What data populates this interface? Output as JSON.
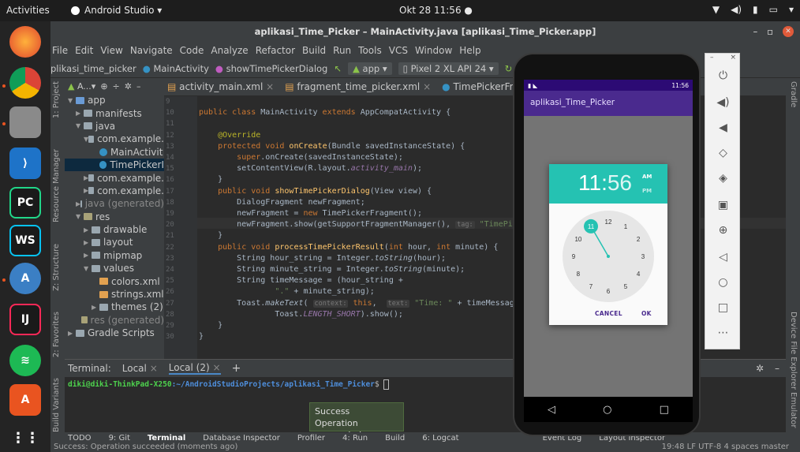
{
  "topbar": {
    "activities": "Activities",
    "app_name": "Android Studio ▾",
    "clock": "Okt 28 11:56  ●"
  },
  "window": {
    "title": "aplikasi_Time_Picker – MainActivity.java [aplikasi_Time_Picker.app]"
  },
  "menu": [
    "File",
    "Edit",
    "View",
    "Navigate",
    "Code",
    "Analyze",
    "Refactor",
    "Build",
    "Run",
    "Tools",
    "VCS",
    "Window",
    "Help"
  ],
  "nav": {
    "project": "plikasi_time_picker",
    "class": "MainActivity",
    "method": "showTimePickerDialog",
    "run_config": "app ▾",
    "device": "Pixel 2 XL API 24 ▾"
  },
  "project_panel": {
    "header": "A...▾",
    "tree": [
      {
        "label": "app",
        "indent": 0,
        "type": "fold-blue",
        "arrow": "▼"
      },
      {
        "label": "manifests",
        "indent": 1,
        "type": "fold",
        "arrow": "▶"
      },
      {
        "label": "java",
        "indent": 1,
        "type": "fold",
        "arrow": "▼"
      },
      {
        "label": "com.example.",
        "indent": 2,
        "type": "fold",
        "arrow": "▼"
      },
      {
        "label": "MainActivit",
        "indent": 3,
        "type": "cls",
        "arrow": ""
      },
      {
        "label": "TimePickerI",
        "indent": 3,
        "type": "cls",
        "arrow": "",
        "selected": true
      },
      {
        "label": "com.example.",
        "indent": 2,
        "type": "fold",
        "arrow": "▶"
      },
      {
        "label": "com.example.",
        "indent": 2,
        "type": "fold",
        "arrow": "▶"
      },
      {
        "label": "java (generated)",
        "indent": 1,
        "type": "fold",
        "arrow": "▶"
      },
      {
        "label": "res",
        "indent": 1,
        "type": "fold-res",
        "arrow": "▼"
      },
      {
        "label": "drawable",
        "indent": 2,
        "type": "fold",
        "arrow": "▶"
      },
      {
        "label": "layout",
        "indent": 2,
        "type": "fold",
        "arrow": "▶"
      },
      {
        "label": "mipmap",
        "indent": 2,
        "type": "fold",
        "arrow": "▶"
      },
      {
        "label": "values",
        "indent": 2,
        "type": "fold",
        "arrow": "▼"
      },
      {
        "label": "colors.xml",
        "indent": 3,
        "type": "xmlf",
        "arrow": ""
      },
      {
        "label": "strings.xml",
        "indent": 3,
        "type": "xmlf",
        "arrow": ""
      },
      {
        "label": "themes (2)",
        "indent": 3,
        "type": "fold",
        "arrow": "▶"
      },
      {
        "label": "res (generated)",
        "indent": 1,
        "type": "fold-res",
        "arrow": ""
      },
      {
        "label": "Gradle Scripts",
        "indent": 0,
        "type": "fold",
        "arrow": "▶"
      }
    ]
  },
  "left_tabs": [
    "1: Project",
    "Resource Manager",
    "Z: Structure",
    "2: Favorites",
    "Build Variants"
  ],
  "right_tabs": [
    "Gradle",
    "Device File Explorer",
    "Emulator"
  ],
  "tabs": [
    "activity_main.xml",
    "fragment_time_picker.xml",
    "TimePickerFragment.java"
  ],
  "code": {
    "line_numbers": [
      "9",
      "10",
      "11",
      "12",
      "13",
      "14",
      "15",
      "16",
      "17",
      "18",
      "19",
      "20",
      "21",
      "22",
      "23",
      "24",
      "25",
      "26",
      "27",
      "28",
      "29",
      "30"
    ],
    "lines": [
      "",
      "<span class=\"kw\">public class</span> MainActivity <span class=\"kw\">extends</span> AppCompatActivity {",
      "",
      "    <span class=\"ann\">@Override</span>",
      "    <span class=\"kw\">protected void</span> <span class=\"mth\">onCreate</span>(Bundle savedInstanceState) {",
      "        <span class=\"kw\">super</span>.onCreate(savedInstanceState);",
      "        setContentView(R.layout.<span class=\"fld\">activity_main</span>);",
      "    }",
      "    <span class=\"kw\">public void</span> <span class=\"mth\">showTimePickerDialog</span>(View view) {",
      "        DialogFragment newFragment;",
      "        newFragment = <span class=\"kw\">new</span> TimePickerFragment();",
      "        newFragment.show(getSupportFragmentManager(), <span class=\"hint\">tag:</span> <span class=\"str\">\"TimePicker\"</span>);",
      "    }",
      "    <span class=\"kw\">public void</span> <span class=\"mth\">processTimePickerResult</span>(<span class=\"kw\">int</span> hour, <span class=\"kw\">int</span> minute) {",
      "        String hour_string = Integer.<span class=\"ital\">toString</span>(hour);",
      "        String minute_string = Integer.<span class=\"ital\">toString</span>(minute);",
      "        String timeMessage = (hour_string +",
      "                <span class=\"str\">\".\"</span> + minute_string);",
      "        Toast.<span class=\"ital\">makeText</span>( <span class=\"hint\">context:</span> <span class=\"kw\">this</span>,  <span class=\"hint\">text:</span> <span class=\"str\">\"Time: \"</span> + timeMessage,",
      "                Toast.<span class=\"fld\">LENGTH_SHORT</span>).show();",
      "    }",
      "}"
    ]
  },
  "terminal": {
    "label": "Terminal:",
    "tabs": [
      "Local",
      "Local (2)"
    ],
    "prompt_user": "diki@diki-ThinkPad-X250",
    "prompt_path": ":~/AndroidStudioProjects/aplikasi_Time_Picker",
    "prompt_end": "$"
  },
  "popup": {
    "title": "Success",
    "message": "Operation succeeded"
  },
  "bottom_tools": [
    "TODO",
    "9: Git",
    "Terminal",
    "Database Inspector",
    "Profiler",
    "4: Run",
    "Build",
    "6: Logcat",
    "Event Log",
    "Layout Inspector"
  ],
  "statusbar": {
    "message": "Success: Operation succeeded (moments ago)",
    "right": "19:48  LF  UTF-8  4 spaces  master"
  },
  "phone": {
    "status_time": "11:56",
    "app_title": "aplikasi_Time_Picker",
    "picker": {
      "hour": "11",
      "minute": "56",
      "am": "AM",
      "pm": "PM",
      "selected_hour": 11,
      "hours": [
        "12",
        "1",
        "2",
        "3",
        "4",
        "5",
        "6",
        "7",
        "8",
        "9",
        "10",
        "11"
      ],
      "cancel": "CANCEL",
      "ok": "OK"
    }
  },
  "colors": {
    "accent": "#25c2b2",
    "app_bar": "#4a2a8e",
    "status_bar": "#2c0a74"
  }
}
